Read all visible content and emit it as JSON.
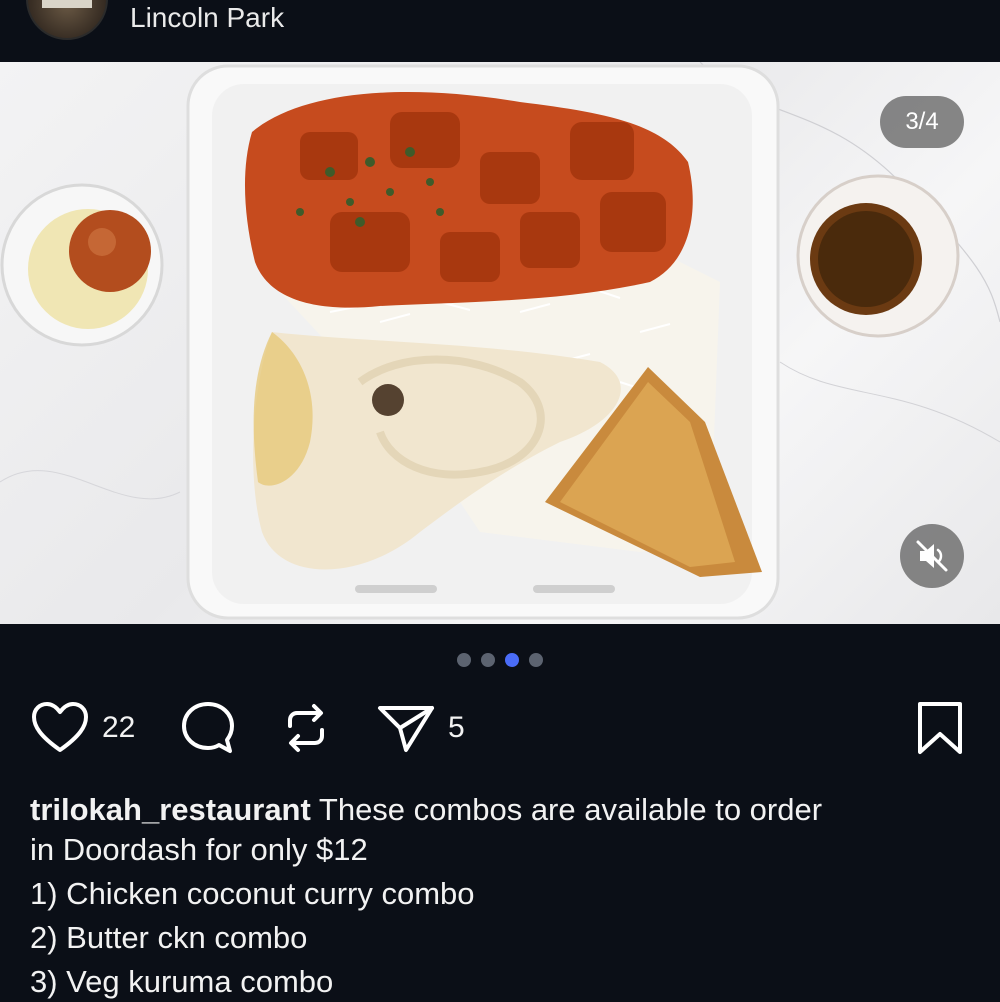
{
  "header": {
    "location": "Lincoln Park"
  },
  "media": {
    "counter": "3/4",
    "slide_count": 4,
    "active_slide": 3
  },
  "actions": {
    "likes": "22",
    "shares": "5"
  },
  "caption": {
    "username": "trilokah_restaurant",
    "text_line1": "These combos are available to order",
    "text_line2": "in Doordash for only $12",
    "items": [
      "1) Chicken coconut curry combo",
      "2) Butter ckn combo",
      "3) Veg kuruma combo"
    ]
  },
  "colors": {
    "background": "#0b0f17",
    "active_dot": "#4a6cf7",
    "inactive_dot": "#5c6370"
  },
  "icons": [
    "heart-icon",
    "comment-icon",
    "repost-icon",
    "share-icon",
    "bookmark-icon",
    "mute-icon"
  ]
}
